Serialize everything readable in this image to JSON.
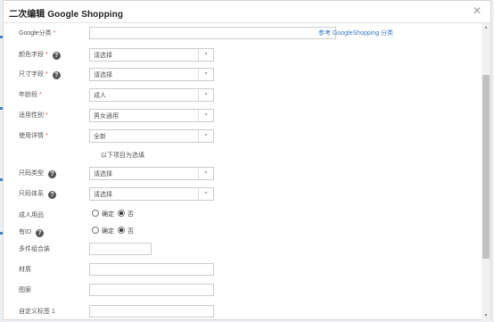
{
  "dialog": {
    "title": "二次编辑 Google Shopping",
    "close_glyph": "✕"
  },
  "form": {
    "google_category": {
      "label": "Google分类",
      "required_mark": "*",
      "value": "",
      "link": "参考 GoogleShopping 分类"
    },
    "color_field": {
      "label": "颜色字段",
      "required_mark": "*",
      "value": "请选择"
    },
    "size_field": {
      "label": "尺寸字段",
      "required_mark": "*",
      "value": "请选择"
    },
    "age_group": {
      "label": "年龄段",
      "required_mark": "*",
      "value": "成人"
    },
    "gender": {
      "label": "适用性别",
      "required_mark": "*",
      "value": "男女通用"
    },
    "condition": {
      "label": "使用详情",
      "required_mark": "*",
      "value": "全新"
    },
    "optional_note": "以下项目为选填",
    "size_type": {
      "label": "尺码类型",
      "value": "请选择"
    },
    "size_system": {
      "label": "尺码体系",
      "value": "请选择"
    },
    "adult": {
      "label": "成人用品",
      "option_yes": "确定",
      "option_no": "否",
      "selected": "否"
    },
    "identifier": {
      "label": "有ID",
      "option_yes": "确定",
      "option_no": "否",
      "selected": "否"
    },
    "multipack": {
      "label": "多件组合装",
      "value": ""
    },
    "material": {
      "label": "材质",
      "value": ""
    },
    "pattern": {
      "label": "图案",
      "value": ""
    },
    "custom_label_1": {
      "label": "自定义标签 1",
      "value": ""
    }
  },
  "icons": {
    "help": "?",
    "caret": "▾"
  }
}
